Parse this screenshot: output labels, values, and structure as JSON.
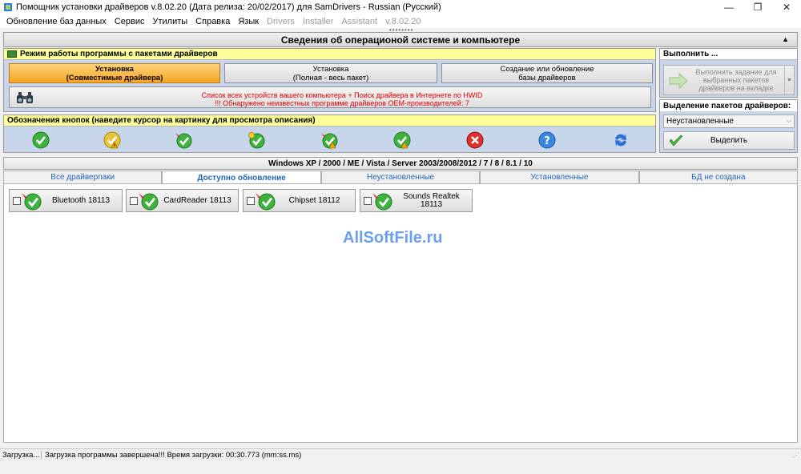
{
  "window": {
    "title": "Помощник установки драйверов v.8.02.20 (Дата релиза: 20/02/2017) для SamDrivers - Russian (Русский)",
    "minimize": "—",
    "maximize": "❐",
    "close": "✕"
  },
  "menu": [
    {
      "label": "Обновление баз данных",
      "enabled": true
    },
    {
      "label": "Сервис",
      "enabled": true
    },
    {
      "label": "Утилиты",
      "enabled": true
    },
    {
      "label": "Справка",
      "enabled": true
    },
    {
      "label": "Язык",
      "enabled": true
    },
    {
      "label": "Drivers",
      "enabled": false
    },
    {
      "label": "Installer",
      "enabled": false
    },
    {
      "label": "Assistant",
      "enabled": false
    },
    {
      "label": "v.8.02.20",
      "enabled": false
    }
  ],
  "grip": "••••••••",
  "sysinfo": {
    "title": "Сведения об операционой системе и компьютере",
    "collapse": "▲"
  },
  "mode_panel": {
    "title": "Режим работы программы с пакетами драйверов",
    "buttons": [
      {
        "line1": "Установка",
        "line2": "(Совместимые драйвера)",
        "active": true
      },
      {
        "line1": "Установка",
        "line2": "(Полная - весь пакет)",
        "active": false
      },
      {
        "line1": "Создание или обновление",
        "line2": "базы драйверов",
        "active": false
      }
    ],
    "search_line1": "Список всех устройств вашего компьютера + Поиск драйвера в Интернете по HWID",
    "search_line2": "!!! Обнаружено неизвестных программе драйверов OEM-производителей: 7"
  },
  "legend_panel": {
    "title": "Обозначения кнопок (наведите курсор на картинку для просмотра описания)",
    "icons": [
      "check-icon",
      "check-warning-icon",
      "check-pin-icon",
      "check-bulb-icon",
      "check-pin-warning-icon",
      "check-warning-2-icon",
      "error-icon",
      "question-icon",
      "refresh-icon"
    ]
  },
  "exec_panel": {
    "title": "Выполнить ...",
    "button": "Выполнить задание для выбранных пакетов драйверов на вкладке",
    "dropdown": "▼"
  },
  "select_panel": {
    "title": "Выделение пакетов драйверов:",
    "selected": "Неустановленные",
    "dropdown": "⌵",
    "button": "Выделить"
  },
  "os_bar": "Windows XP / 2000 / ME / Vista / Server 2003/2008/2012 / 7 / 8 / 8.1 / 10",
  "tabs": [
    {
      "label": "Все драйверпаки",
      "active": false
    },
    {
      "label": "Доступно обновление",
      "active": true
    },
    {
      "label": "Неустановленные",
      "active": false
    },
    {
      "label": "Установленные",
      "active": false
    },
    {
      "label": "БД не создана",
      "active": false
    }
  ],
  "packages": [
    {
      "name": "Bluetooth 18113",
      "checked": false
    },
    {
      "name": "CardReader 18113",
      "checked": false
    },
    {
      "name": "Chipset 18112",
      "checked": false
    },
    {
      "name": "Sounds Realtek 18113",
      "checked": false
    }
  ],
  "watermark": "AllSoftFile.ru",
  "status": {
    "left": "Загрузка...",
    "right": "Загрузка программы завершена!!! Время загрузки: 00:30.773 (mm:ss.ms)",
    "grip": "⋰"
  },
  "colors": {
    "panel_bg": "#c8d6ec",
    "header_yellow": "#ffff99",
    "active_button": "#f5a623",
    "tab_text": "#2266bb",
    "search_text": "#e00000",
    "watermark": "#6aa0ef"
  }
}
